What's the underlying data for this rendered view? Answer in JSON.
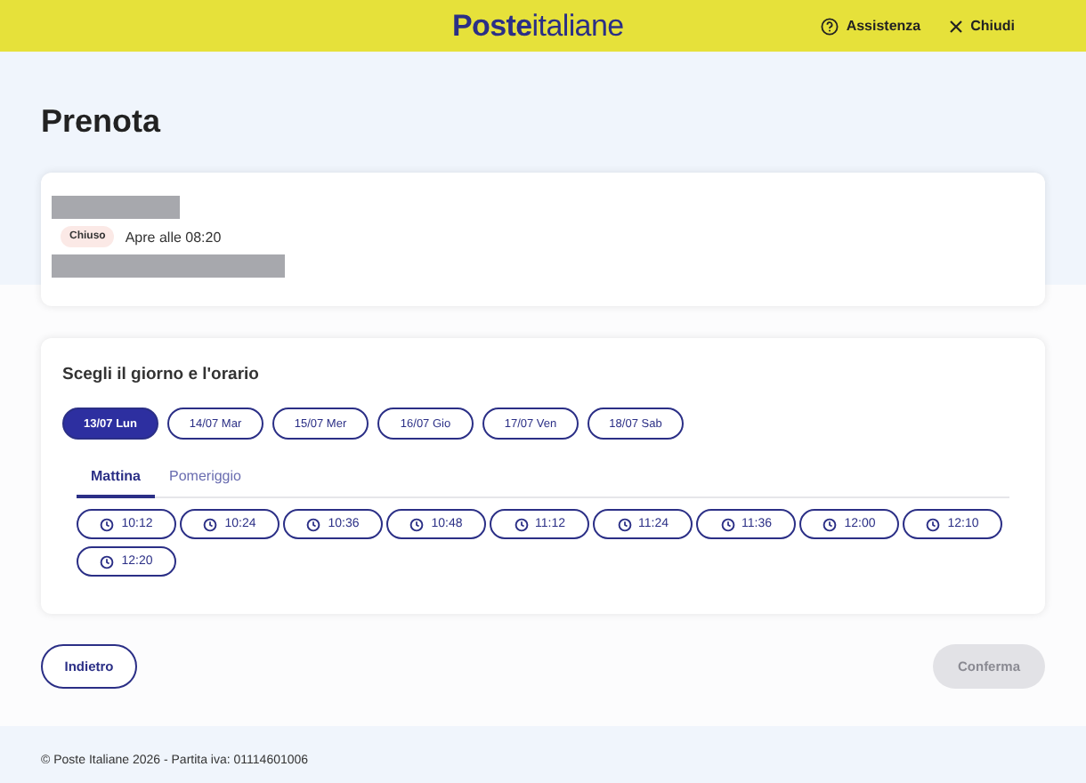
{
  "header": {
    "logo": "**Poste**italiane",
    "actions": [
      {
        "kind": "help",
        "label": "Assistenza"
      },
      {
        "kind": "close",
        "label": "Chiudi"
      }
    ]
  },
  "title": "Prenota",
  "office": {
    "status": "Chiuso",
    "opening": "Apre alle 08:20"
  },
  "booking": {
    "heading": "Scegli il giorno e l'orario",
    "days": [
      {
        "label": "13/07 Lun",
        "selected": true
      },
      {
        "label": "14/07 Mar",
        "selected": false
      },
      {
        "label": "15/07 Mer",
        "selected": false
      },
      {
        "label": "16/07 Gio",
        "selected": false
      },
      {
        "label": "17/07 Ven",
        "selected": false
      },
      {
        "label": "18/07 Sab",
        "selected": false
      }
    ],
    "tabs": [
      {
        "label": "Mattina",
        "selected": true
      },
      {
        "label": "Pomeriggio",
        "selected": false
      }
    ],
    "times": [
      "10:12",
      "10:24",
      "10:36",
      "10:48",
      "11:12",
      "11:24",
      "11:36",
      "12:00",
      "12:10",
      "12:20"
    ]
  },
  "buttons": [
    {
      "label": "Indietro",
      "disabled": false
    },
    {
      "label": "Conferma",
      "disabled": true
    }
  ],
  "footer": "© Poste Italiane 2026 - Partita iva: 01114601006"
}
